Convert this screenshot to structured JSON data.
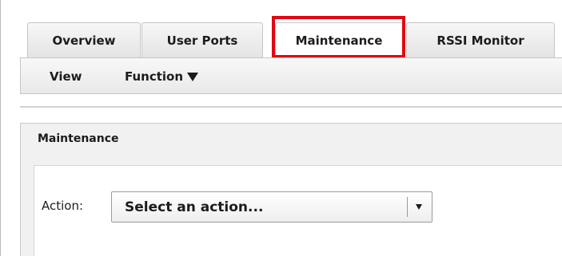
{
  "tabs": [
    {
      "label": "Overview"
    },
    {
      "label": "User Ports"
    },
    {
      "label": "Maintenance",
      "active": true
    },
    {
      "label": "RSSI Monitor"
    }
  ],
  "subnav": {
    "view_label": "View",
    "function_label": "Function"
  },
  "panel": {
    "title": "Maintenance",
    "action_label": "Action:",
    "action_select_value": "Select an action..."
  },
  "colors": {
    "highlight": "#e30613"
  }
}
